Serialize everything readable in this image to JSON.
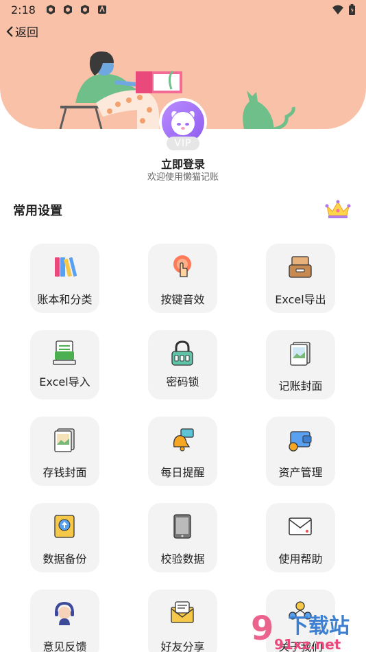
{
  "status_bar": {
    "time": "2:18"
  },
  "header": {
    "back_label": "返回"
  },
  "profile": {
    "vip_label": "VIP",
    "login_label": "立即登录",
    "welcome_text": "欢迎使用懒猫记账"
  },
  "section": {
    "title": "常用设置"
  },
  "tiles": [
    {
      "label": "账本和分类",
      "icon": "books-icon"
    },
    {
      "label": "按键音效",
      "icon": "tap-sound-icon"
    },
    {
      "label": "Excel导出",
      "icon": "export-drawer-icon"
    },
    {
      "label": "Excel导入",
      "icon": "xls-import-icon"
    },
    {
      "label": "密码锁",
      "icon": "padlock-icon"
    },
    {
      "label": "记账封面",
      "icon": "photo-cover-icon"
    },
    {
      "label": "存钱封面",
      "icon": "savings-cover-icon"
    },
    {
      "label": "每日提醒",
      "icon": "bell-reminder-icon"
    },
    {
      "label": "资产管理",
      "icon": "wallet-icon"
    },
    {
      "label": "数据备份",
      "icon": "backup-upload-icon"
    },
    {
      "label": "校验数据",
      "icon": "tablet-check-icon"
    },
    {
      "label": "使用帮助",
      "icon": "envelope-help-icon"
    },
    {
      "label": "意见反馈",
      "icon": "headset-support-icon"
    },
    {
      "label": "好友分享",
      "icon": "share-mail-icon"
    },
    {
      "label": "关于我们",
      "icon": "team-icon"
    }
  ],
  "watermark": {
    "main": "下载站",
    "sub": "91xz.net"
  },
  "colors": {
    "header_bg": "#f9c1a7",
    "tile_bg": "#f3f3f3",
    "avatar": "#a06ef5"
  }
}
